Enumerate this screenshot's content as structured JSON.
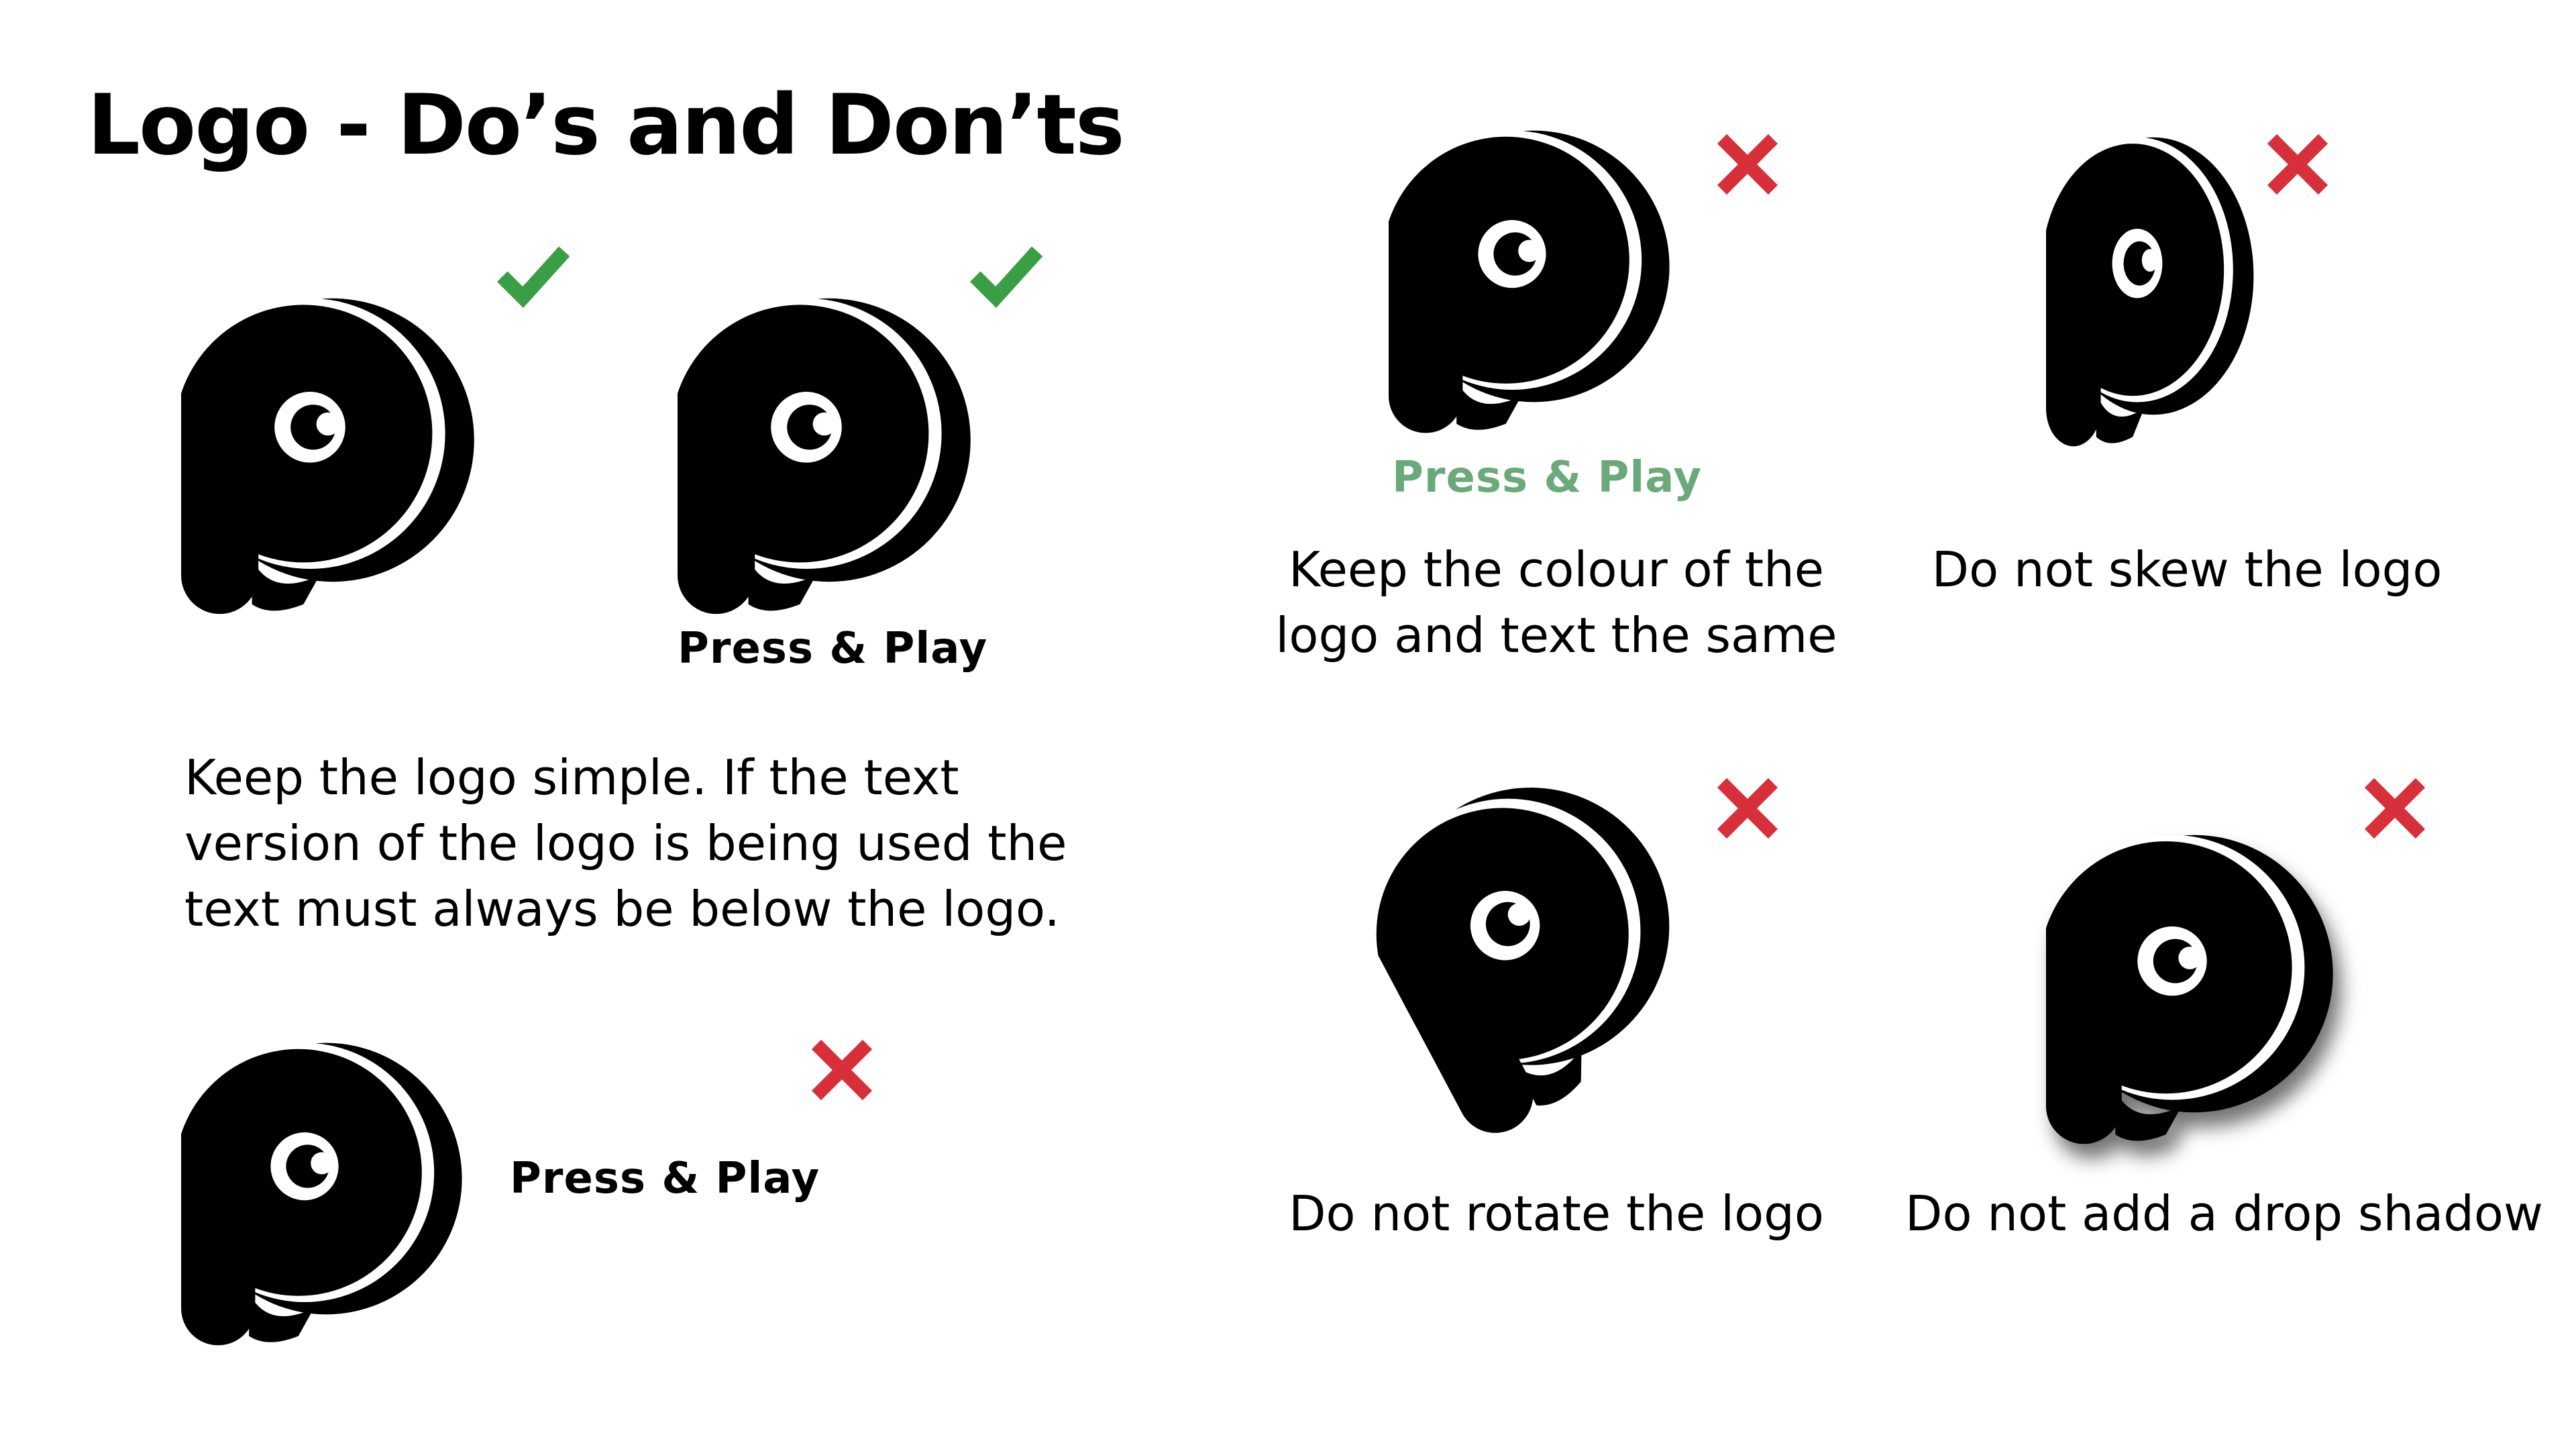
{
  "title": "Logo - Do’s and Don’ts",
  "brand_text": "Press & Play",
  "colors": {
    "logo": "#000000",
    "check": "#3a9e44",
    "cross": "#d8303a",
    "green_text": "#6aa97a"
  },
  "icons": {
    "do": "check-icon",
    "dont": "cross-icon"
  },
  "examples": {
    "logo_only": {
      "verdict": "do"
    },
    "logo_text_below": {
      "verdict": "do",
      "text": "Press & Play"
    },
    "logo_text_side": {
      "verdict": "dont",
      "text": "Press & Play"
    },
    "colour": {
      "verdict": "dont",
      "text": "Press & Play",
      "caption_line1": "Keep the colour of the",
      "caption_line2": "logo and text the same"
    },
    "skew": {
      "verdict": "dont",
      "caption": "Do not skew the logo"
    },
    "rotate": {
      "verdict": "dont",
      "caption": "Do not rotate the logo"
    },
    "shadow": {
      "verdict": "dont",
      "caption": "Do not add a drop shadow"
    }
  },
  "guideline": {
    "line1": "Keep the logo simple. If the text",
    "line2": "version of the logo is being used the",
    "line3": "text must always be below the logo."
  }
}
